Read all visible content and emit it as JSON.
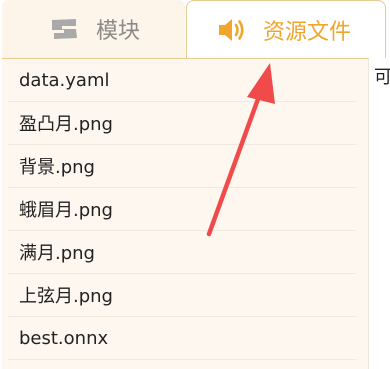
{
  "tabs": [
    {
      "label": "模块",
      "icon": "module-icon"
    },
    {
      "label": "资源文件",
      "icon": "speaker-icon",
      "active": true
    }
  ],
  "files": [
    "data.yaml",
    "盈凸月.png",
    "背景.png",
    "蛾眉月.png",
    "满月.png",
    "上弦月.png",
    "best.onnx"
  ],
  "side_text": "可",
  "colors": {
    "accent": "#f0a52c",
    "arrow": "#f04a4a",
    "panel_bg": "#fdf7f0",
    "inactive_tab_bg": "#fdf5ea",
    "inactive_text": "#8a8a8a"
  }
}
